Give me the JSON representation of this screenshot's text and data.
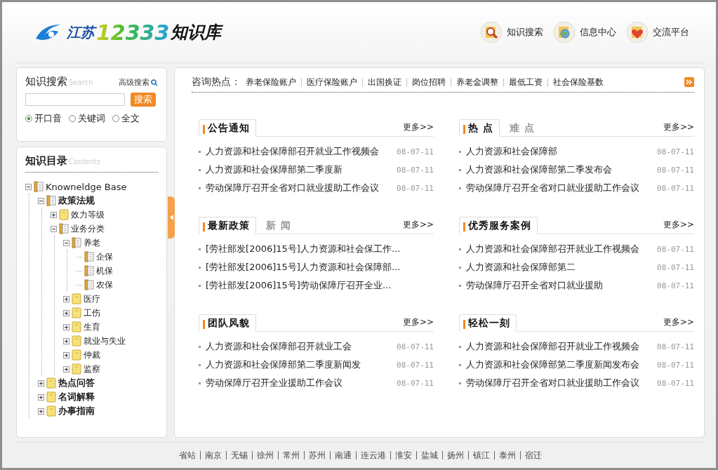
{
  "logo": {
    "region": "江苏",
    "number": "12333",
    "name": "知识库"
  },
  "nav": [
    {
      "label": "知识搜索",
      "kind": "search"
    },
    {
      "label": "信息中心",
      "kind": "globe"
    },
    {
      "label": "交流平台",
      "kind": "heart"
    }
  ],
  "search": {
    "title": "知识搜索",
    "subtitle": "Search",
    "advanced": "高级搜索",
    "button": "搜索",
    "options": [
      {
        "label": "开口音",
        "selected": true
      },
      {
        "label": "关键词",
        "selected": false
      },
      {
        "label": "全文",
        "selected": false
      }
    ]
  },
  "tree": {
    "title": "知识目录",
    "subtitle": "Contents",
    "nodes": [
      {
        "label": "Knowneldge Base",
        "expanded": true,
        "children": [
          {
            "label": "政策法规",
            "expanded": true,
            "children": [
              {
                "label": "效力等级",
                "expanded": false
              },
              {
                "label": "业务分类",
                "expanded": true,
                "children": [
                  {
                    "label": "养老",
                    "expanded": true,
                    "children": [
                      {
                        "label": "企保"
                      },
                      {
                        "label": "机保"
                      },
                      {
                        "label": "农保"
                      }
                    ]
                  },
                  {
                    "label": "医疗",
                    "expanded": false
                  },
                  {
                    "label": "工伤",
                    "expanded": false
                  },
                  {
                    "label": "生育",
                    "expanded": false
                  },
                  {
                    "label": "就业与失业",
                    "expanded": false
                  },
                  {
                    "label": "仲裁",
                    "expanded": false
                  },
                  {
                    "label": "监察",
                    "expanded": false
                  }
                ]
              }
            ]
          },
          {
            "label": "热点问答",
            "expanded": false
          },
          {
            "label": "名词解释",
            "expanded": false
          },
          {
            "label": "办事指南",
            "expanded": false
          }
        ]
      }
    ]
  },
  "hot": {
    "label": "咨询热点：",
    "links": [
      "养老保险账户",
      "医疗保险账户",
      "出国换证",
      "岗位招聘",
      "养老金调整",
      "最低工资",
      "社会保险基数"
    ]
  },
  "panels": [
    {
      "tabs": [
        {
          "label": "公告通知",
          "selected": true
        }
      ],
      "more": "更多>>",
      "items": [
        {
          "title": "人力资源和社会保障部召开就业工作视频会",
          "date": "08-07-11"
        },
        {
          "title": "人力资源和社会保障部第二季度新",
          "date": "08-07-11"
        },
        {
          "title": "劳动保障厅召开全省对口就业援助工作会议",
          "date": "08-07-11"
        }
      ]
    },
    {
      "tabs": [
        {
          "label": "热 点",
          "selected": true
        },
        {
          "label": "难 点",
          "selected": false
        }
      ],
      "more": "更多>>",
      "items": [
        {
          "title": "人力资源和社会保障部",
          "date": "08-07-11"
        },
        {
          "title": "人力资源和社会保障部第二季发布会",
          "date": "08-07-11"
        },
        {
          "title": "劳动保障厅召开全省对口就业援助工作会议",
          "date": "08-07-11"
        }
      ]
    },
    {
      "tabs": [
        {
          "label": "最新政策",
          "selected": true
        },
        {
          "label": "新 闻",
          "selected": false
        }
      ],
      "more": "更多>>",
      "items": [
        {
          "title": "[劳社部发[2006]15号]人力资源和社会保工作..."
        },
        {
          "title": "[劳社部发[2006]15号]人力资源和社会保障部..."
        },
        {
          "title": "[劳社部发[2006]15号]劳动保障厅召开全业..."
        }
      ]
    },
    {
      "tabs": [
        {
          "label": "优秀服务案例",
          "selected": true
        }
      ],
      "more": "更多>>",
      "items": [
        {
          "title": "人力资源和社会保障部召开就业工作视频会",
          "date": "08-07-11"
        },
        {
          "title": "人力资源和社会保障部第二",
          "date": "08-07-11"
        },
        {
          "title": "劳动保障厅召开全省对口就业援助",
          "date": "08-07-11"
        }
      ]
    },
    {
      "tabs": [
        {
          "label": "团队风貌",
          "selected": true
        }
      ],
      "more": "更多>>",
      "items": [
        {
          "title": "人力资源和社会保障部召开就业工会",
          "date": "08-07-11"
        },
        {
          "title": "人力资源和社会保障部第二季度新闻发",
          "date": "08-07-11"
        },
        {
          "title": "劳动保障厅召开全业援助工作会议",
          "date": "08-07-11"
        }
      ]
    },
    {
      "tabs": [
        {
          "label": "轻松一刻",
          "selected": true
        }
      ],
      "more": "更多>>",
      "items": [
        {
          "title": "人力资源和社会保障部召开就业工作视频会",
          "date": "08-07-11"
        },
        {
          "title": "人力资源和社会保障部第二季度新闻发布会",
          "date": "08-07-11"
        },
        {
          "title": "劳动保障厅召开全省对口就业援助工作会议",
          "date": "08-07-11"
        }
      ]
    }
  ],
  "footer": {
    "links": [
      "省站",
      "南京",
      "无锡",
      "徐州",
      "常州",
      "苏州",
      "南通",
      "连云港",
      "淮安",
      "盐城",
      "扬州",
      "镇江",
      "泰州",
      "宿迁"
    ]
  }
}
